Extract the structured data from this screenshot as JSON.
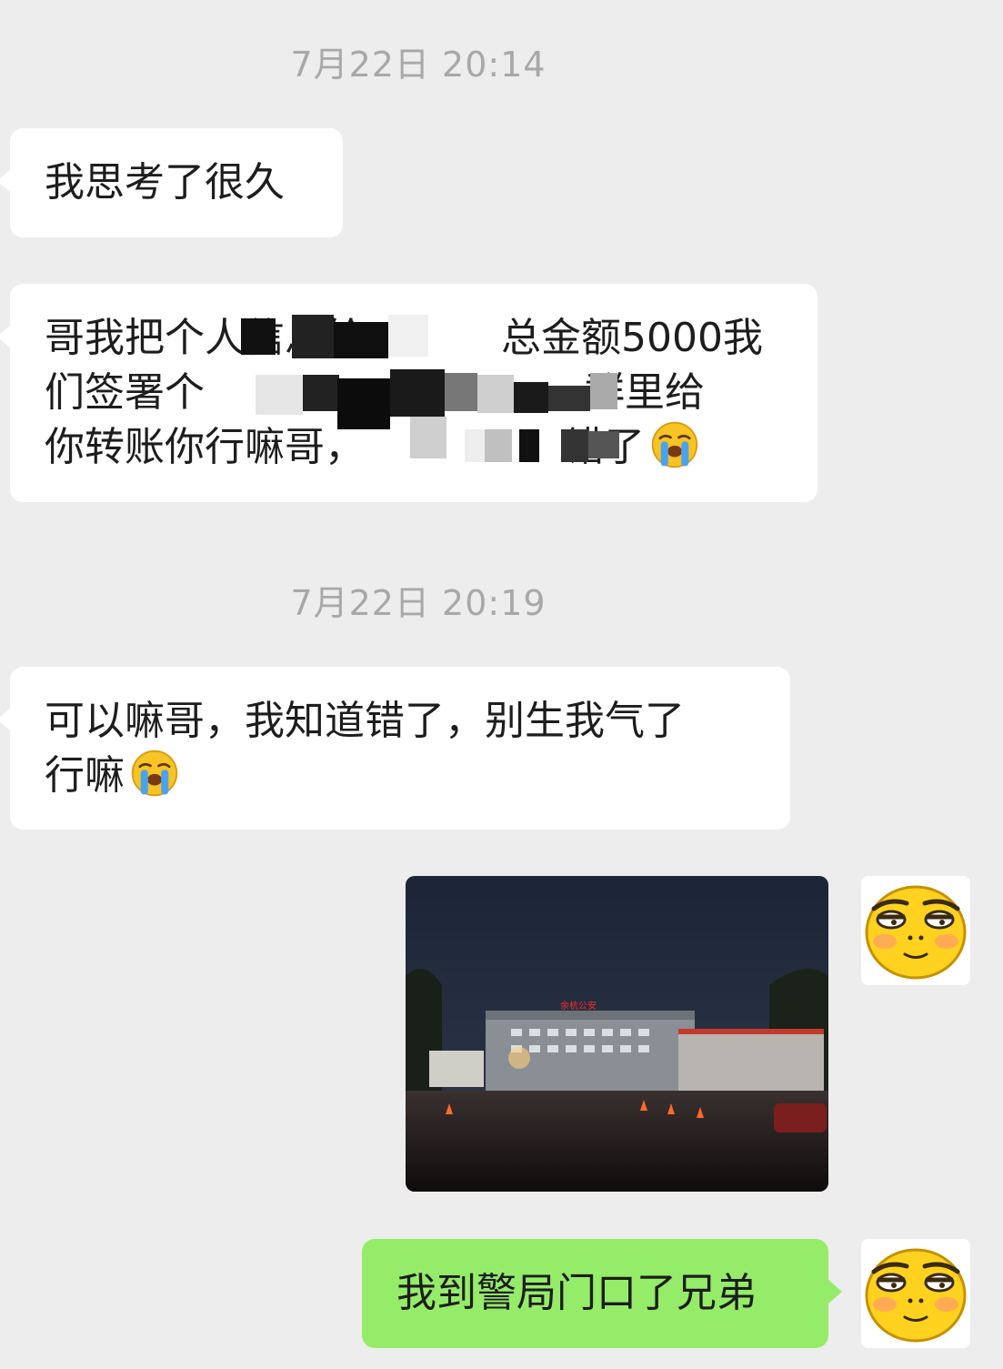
{
  "timestamps": [
    "7月22日 20:14",
    "7月22日 20:19"
  ],
  "messages": {
    "m1": "我思考了很久",
    "m2": {
      "line1_a": "哥我把个人信息给",
      "line1_b": "总金额5000我",
      "line2_a": "们签署个",
      "line2_b": "群里给",
      "line3_a": "你转账你",
      "line3_b": "行嘛哥，",
      "line3_c": "错了"
    },
    "m3": {
      "line1": "可以嘛哥，我知道错了，别生我气了",
      "line2": "行嘛"
    },
    "m4": "我到警局门口了兄弟"
  },
  "photo": {
    "sign": "余杭公安"
  },
  "emoji": {
    "inline": "loudly-crying-face",
    "avatar": "smug-face"
  },
  "colors": {
    "background": "#ededed",
    "incoming_bubble": "#ffffff",
    "outgoing_bubble": "#95ec69",
    "timestamp": "#a8a8a8"
  }
}
